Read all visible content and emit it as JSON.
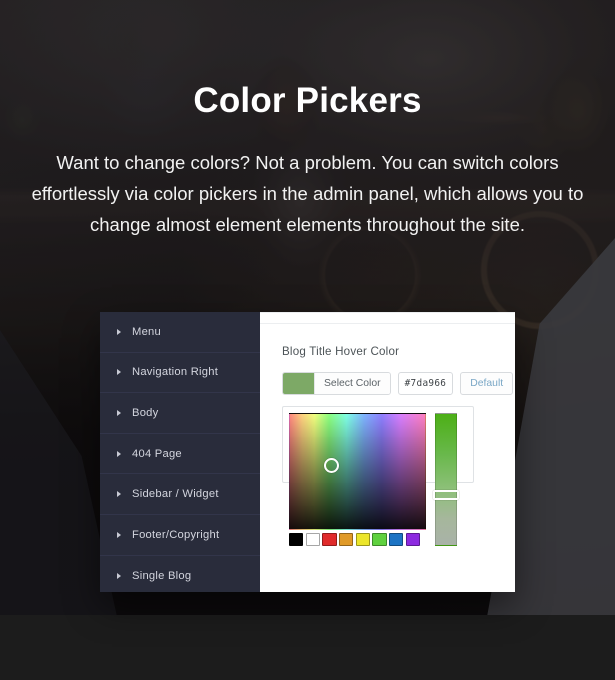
{
  "hero": {
    "title": "Color Pickers",
    "subtitle": "Want to change colors? Not a problem. You can switch colors effortlessly via color pickers in the admin panel, which allows you to change almost element elements throughout the site."
  },
  "panel": {
    "sidebar": {
      "items": [
        {
          "label": "Menu",
          "icon": "caret-right-icon"
        },
        {
          "label": "Navigation Right",
          "icon": "caret-right-icon"
        },
        {
          "label": "Body",
          "icon": "caret-right-icon"
        },
        {
          "label": "404 Page",
          "icon": "caret-right-icon"
        },
        {
          "label": "Sidebar / Widget",
          "icon": "caret-right-icon"
        },
        {
          "label": "Footer/Copyright",
          "icon": "caret-right-icon"
        },
        {
          "label": "Single Blog",
          "icon": "caret-right-icon"
        }
      ]
    },
    "main": {
      "field_label": "Blog Title Hover Color",
      "select_color_label": "Select Color",
      "hex_value": "#7da966",
      "default_label": "Default",
      "current_color": "#7da966",
      "picker": {
        "marker_hue_pct": 25,
        "marker_value_pct": 38,
        "slider_position_pct": 58,
        "slider_top_color": "#4caf16",
        "slider_bottom_color": "#a9b2a8",
        "presets": [
          {
            "name": "black",
            "hex": "#000000"
          },
          {
            "name": "white",
            "hex": "#ffffff"
          },
          {
            "name": "red",
            "hex": "#e02b2b"
          },
          {
            "name": "orange",
            "hex": "#e09a28"
          },
          {
            "name": "yellow",
            "hex": "#ece62a"
          },
          {
            "name": "green",
            "hex": "#5fd13f"
          },
          {
            "name": "blue",
            "hex": "#1d74c4"
          },
          {
            "name": "purple",
            "hex": "#8d2ae0"
          }
        ]
      }
    }
  },
  "theme": {
    "accent_green": "#7da966",
    "sidebar_bg": "#292c3b",
    "panel_bg": "#ffffff",
    "page_bg": "#1c1c1c",
    "default_link": "#7aa7c6"
  }
}
